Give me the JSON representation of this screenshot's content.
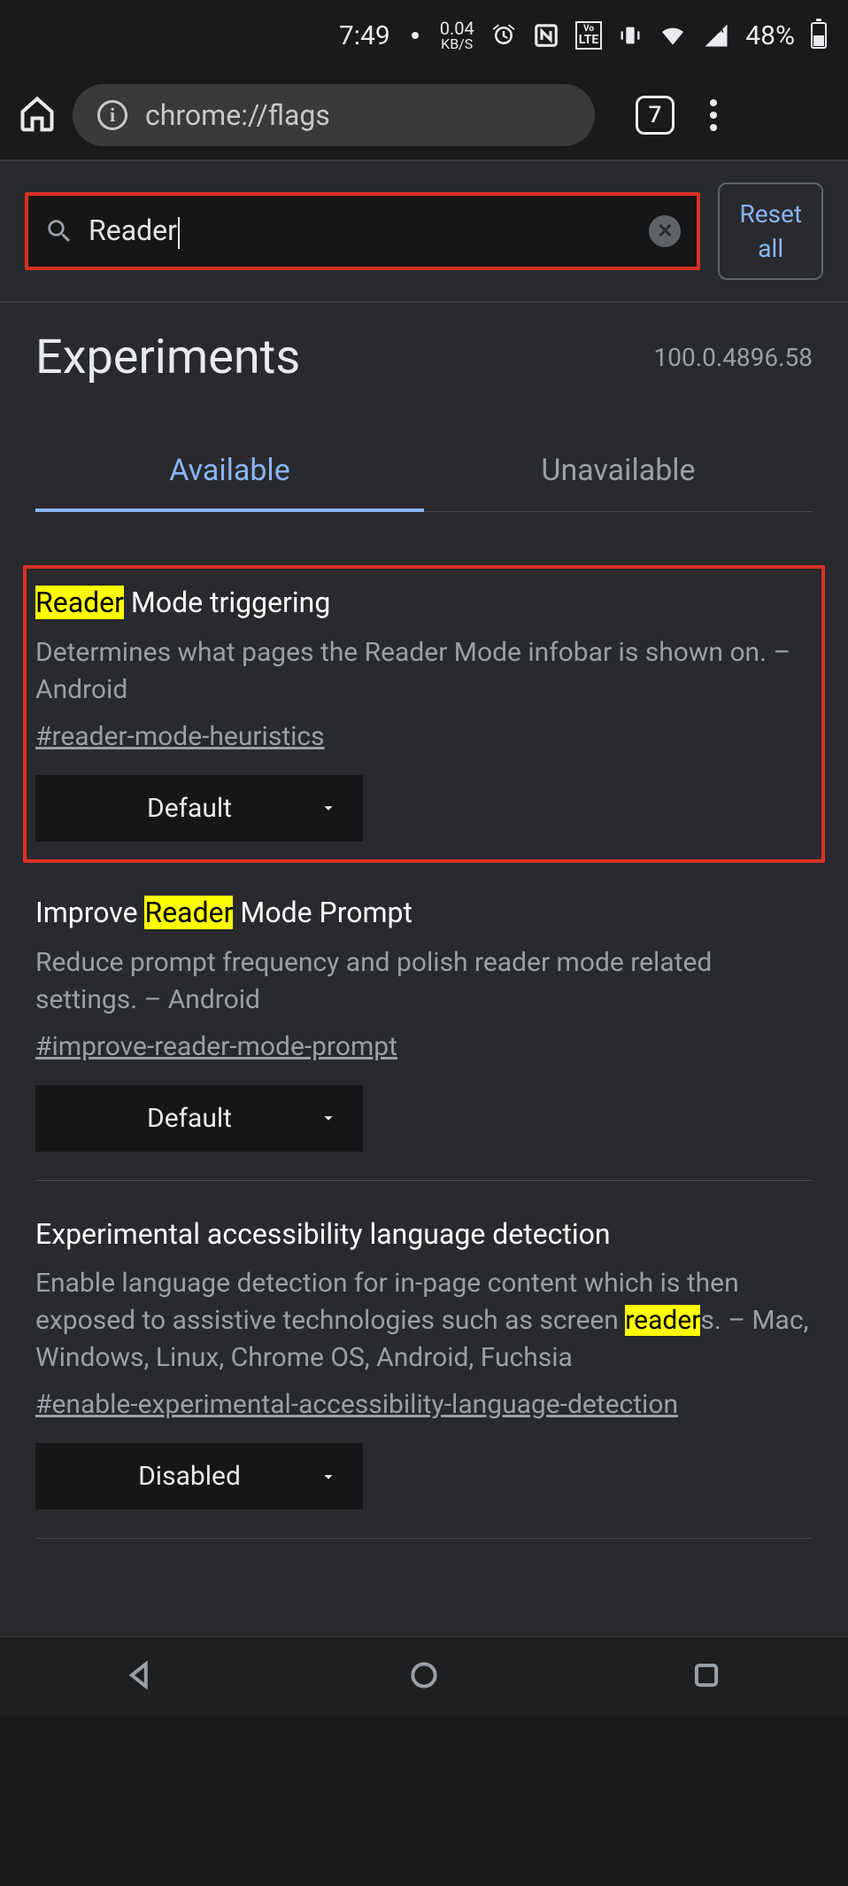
{
  "status": {
    "time": "7:49",
    "speed": "0.04",
    "speed_unit": "KB/S",
    "lte": "LTE",
    "vo": "Vo",
    "battery_pct": "48%"
  },
  "browser": {
    "url": "chrome://flags",
    "tab_count": "7"
  },
  "search": {
    "value": "Reader",
    "reset_label": "Reset all"
  },
  "header": {
    "title": "Experiments",
    "version": "100.0.4896.58"
  },
  "tabs": {
    "available": "Available",
    "unavailable": "Unavailable"
  },
  "flags": [
    {
      "title_pre": "",
      "title_hl": "Reader",
      "title_post": " Mode triggering",
      "desc": "Determines what pages the Reader Mode infobar is shown on. – Android",
      "id": "#reader-mode-heuristics",
      "select": "Default",
      "highlighted": true
    },
    {
      "title_pre": "Improve ",
      "title_hl": "Reader",
      "title_post": " Mode Prompt",
      "desc": "Reduce prompt frequency and polish reader mode related settings. – Android",
      "id": "#improve-reader-mode-prompt",
      "select": "Default",
      "highlighted": false
    },
    {
      "title_full": "Experimental accessibility language detection",
      "desc_pre": "Enable language detection for in-page content which is then exposed to assistive technologies such as screen ",
      "desc_hl": "reader",
      "desc_post": "s. – Mac, Windows, Linux, Chrome OS, Android, Fuchsia",
      "id": "#enable-experimental-accessibility-language-detection",
      "select": "Disabled",
      "highlighted": false
    }
  ]
}
